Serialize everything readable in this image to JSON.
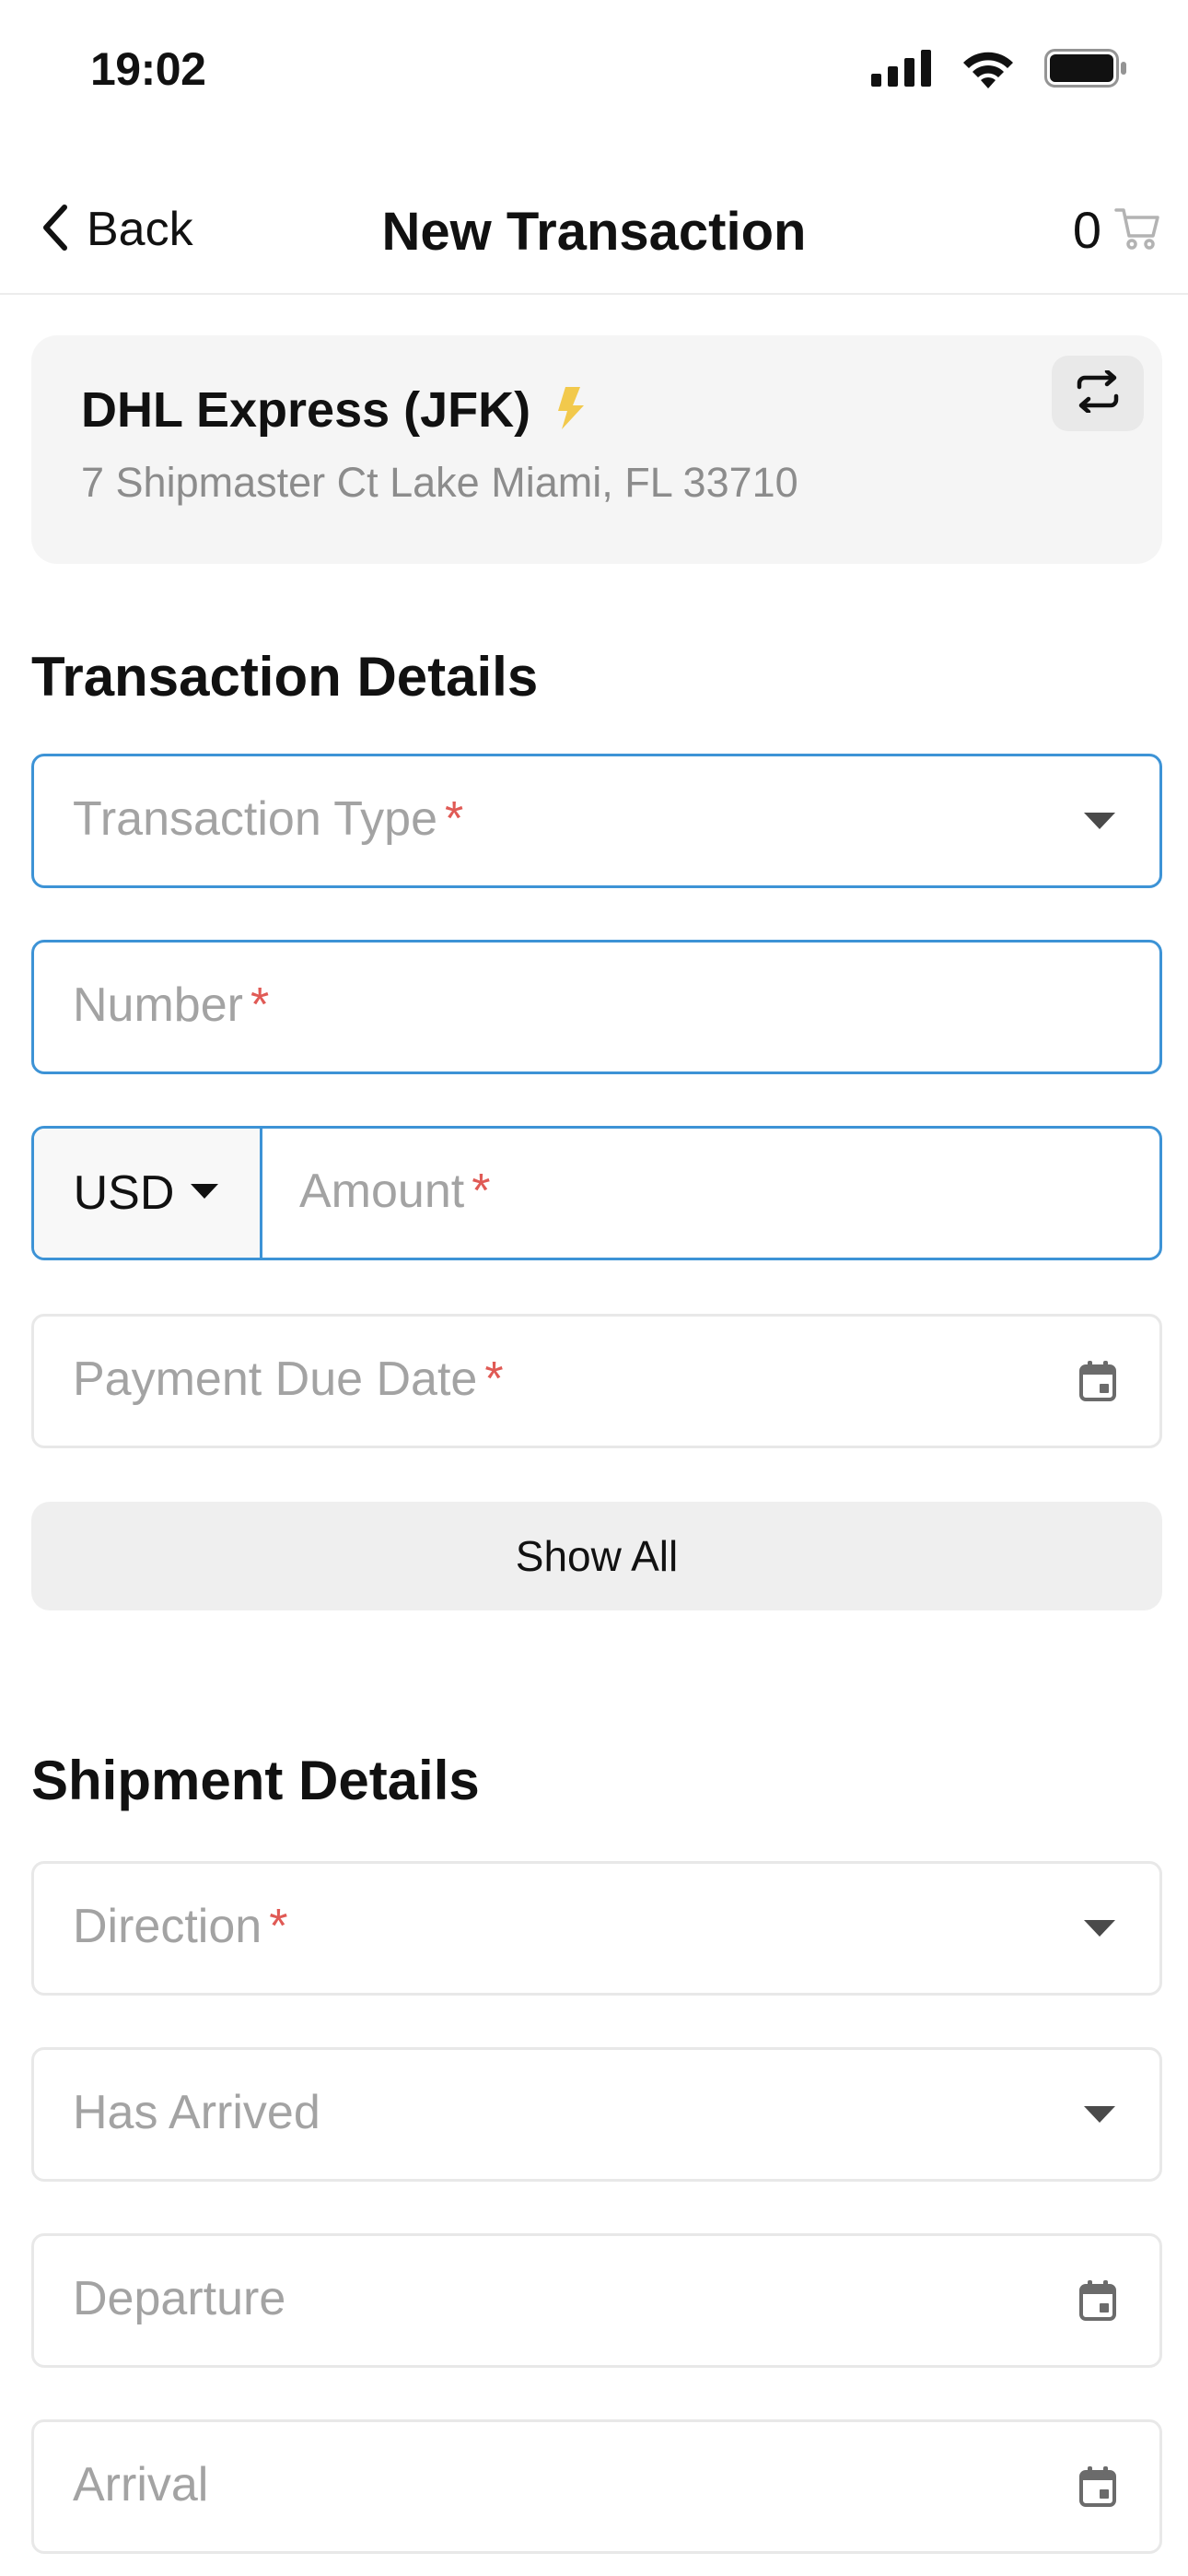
{
  "status_bar": {
    "time": "19:02"
  },
  "nav": {
    "back_label": "Back",
    "title": "New Transaction",
    "cart_count": "0"
  },
  "merchant": {
    "name": "DHL Express (JFK)",
    "address": "7 Shipmaster Ct Lake Miami, FL 33710",
    "accent_color": "#f2c94c"
  },
  "transaction_details": {
    "title": "Transaction Details",
    "transaction_type_placeholder": "Transaction Type",
    "number_placeholder": "Number",
    "currency": "USD",
    "amount_placeholder": "Amount",
    "payment_due_date_placeholder": "Payment Due Date",
    "show_all_label": "Show All"
  },
  "shipment_details": {
    "title": "Shipment Details",
    "direction_placeholder": "Direction",
    "has_arrived_placeholder": "Has Arrived",
    "departure_placeholder": "Departure",
    "arrival_placeholder": "Arrival"
  },
  "required_mark": "*",
  "colors": {
    "active_border": "#3d93d6",
    "required": "#e05a55",
    "placeholder": "#a3a3a3"
  },
  "icons": [
    "cellular-signal-icon",
    "wifi-icon",
    "battery-icon",
    "chevron-left-icon",
    "cart-icon",
    "lightning-icon",
    "swap-icon",
    "caret-down-icon",
    "calendar-icon"
  ]
}
